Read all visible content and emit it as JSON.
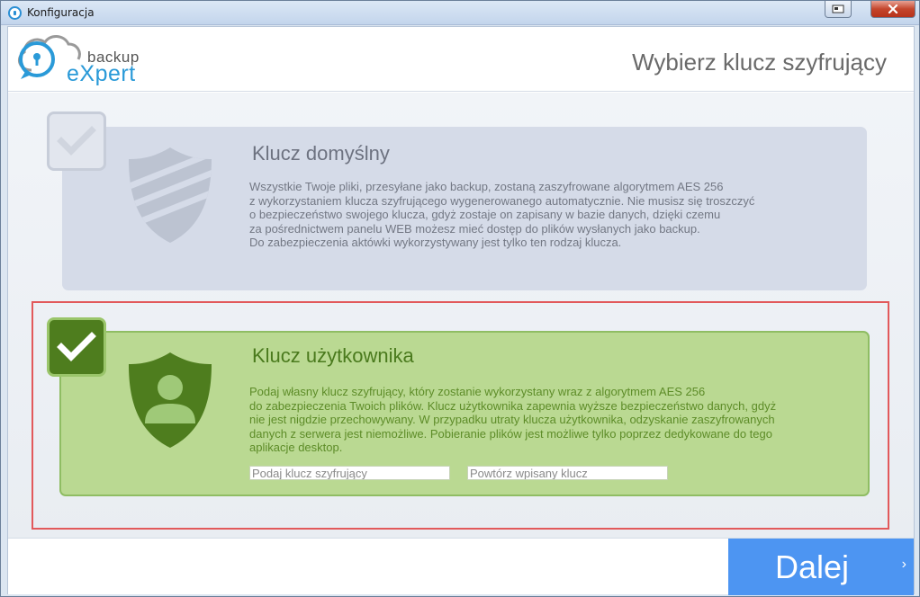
{
  "window": {
    "title": "Konfiguracja"
  },
  "logo": {
    "line1": "backup",
    "line2": "eXpert"
  },
  "header": {
    "title": "Wybierz klucz szyfrujący"
  },
  "options": [
    {
      "title": "Klucz domyślny",
      "description": "Wszystkie Twoje pliki, przesyłane jako backup, zostaną zaszyfrowane algorytmem AES 256\nz wykorzystaniem klucza szyfrującego wygenerowanego automatycznie. Nie musisz się troszczyć\no bezpieczeństwo swojego klucza, gdyż zostaje on zapisany w bazie danych, dzięki czemu\nza pośrednictwem panelu WEB możesz mieć dostęp do plików wysłanych jako backup.\nDo zabezpieczenia aktówki wykorzystywany jest tylko ten rodzaj klucza.",
      "selected": false
    },
    {
      "title": "Klucz użytkownika",
      "description": "Podaj własny klucz szyfrujący, który zostanie wykorzystany wraz z algorytmem AES 256\ndo zabezpieczenia Twoich plików. Klucz użytkownika zapewnia wyższe bezpieczeństwo danych, gdyż\nnie jest nigdzie przechowywany. W przypadku utraty klucza użytkownika, odzyskanie zaszyfrowanych\ndanych z serwera jest niemożliwe. Pobieranie plików jest możliwe tylko poprzez dedykowane do tego\naplikacje desktop.",
      "selected": true,
      "key_placeholder": "Podaj klucz szyfrujący",
      "repeat_placeholder": "Powtórz wpisany klucz",
      "key_value": "",
      "repeat_value": ""
    }
  ],
  "footer": {
    "next_label": "Dalej",
    "next_chevron": "›"
  },
  "colors": {
    "accent_blue": "#4d95f2",
    "selected_green": "#4e7d1e",
    "highlight_red": "#e2595b"
  },
  "icons": {
    "default_check": "check-icon",
    "user_check": "check-icon",
    "default_shield": "shield-stripes-icon",
    "user_shield": "shield-user-icon",
    "app": "backup-expert-app-icon"
  }
}
